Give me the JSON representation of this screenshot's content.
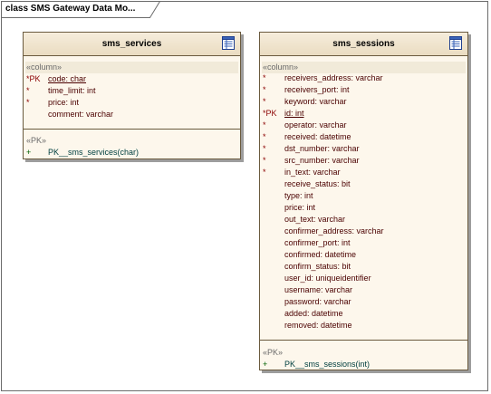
{
  "frame": {
    "title": "class SMS Gateway Data Mo..."
  },
  "tables": [
    {
      "id": "sms_services",
      "title": "sms_services",
      "column_stereotype": "«column»",
      "columns": [
        {
          "marker": "*PK",
          "text": "code:  char",
          "pk": true
        },
        {
          "marker": "*",
          "text": "time_limit:  int",
          "pk": false
        },
        {
          "marker": "*",
          "text": "price:  int",
          "pk": false
        },
        {
          "marker": "",
          "text": "comment:  varchar",
          "pk": false
        }
      ],
      "op_stereotype": "«PK»",
      "operations": [
        {
          "marker": "+",
          "text": "PK__sms_services(char)"
        }
      ]
    },
    {
      "id": "sms_sessions",
      "title": "sms_sessions",
      "column_stereotype": "«column»",
      "columns": [
        {
          "marker": "*",
          "text": "receivers_address:  varchar",
          "pk": false
        },
        {
          "marker": "*",
          "text": "receivers_port:  int",
          "pk": false
        },
        {
          "marker": "*",
          "text": "keyword:  varchar",
          "pk": false
        },
        {
          "marker": "*PK",
          "text": "id:  int",
          "pk": true
        },
        {
          "marker": "*",
          "text": "operator:  varchar",
          "pk": false
        },
        {
          "marker": "*",
          "text": "received:  datetime",
          "pk": false
        },
        {
          "marker": "*",
          "text": "dst_number:  varchar",
          "pk": false
        },
        {
          "marker": "*",
          "text": "src_number:  varchar",
          "pk": false
        },
        {
          "marker": "*",
          "text": "in_text:  varchar",
          "pk": false
        },
        {
          "marker": "",
          "text": "receive_status:  bit",
          "pk": false
        },
        {
          "marker": "",
          "text": "type:  int",
          "pk": false
        },
        {
          "marker": "",
          "text": "price:  int",
          "pk": false
        },
        {
          "marker": "",
          "text": "out_text:  varchar",
          "pk": false
        },
        {
          "marker": "",
          "text": "confirmer_address:  varchar",
          "pk": false
        },
        {
          "marker": "",
          "text": "confirmer_port:  int",
          "pk": false
        },
        {
          "marker": "",
          "text": "confirmed:  datetime",
          "pk": false
        },
        {
          "marker": "",
          "text": "confirm_status:  bit",
          "pk": false
        },
        {
          "marker": "",
          "text": "user_id:  uniqueidentifier",
          "pk": false
        },
        {
          "marker": "",
          "text": "username:  varchar",
          "pk": false
        },
        {
          "marker": "",
          "text": "password:  varchar",
          "pk": false
        },
        {
          "marker": "",
          "text": "added:  datetime",
          "pk": false
        },
        {
          "marker": "",
          "text": "removed:  datetime",
          "pk": false
        }
      ],
      "op_stereotype": "«PK»",
      "operations": [
        {
          "marker": "+",
          "text": "PK__sms_sessions(int)"
        }
      ]
    }
  ]
}
